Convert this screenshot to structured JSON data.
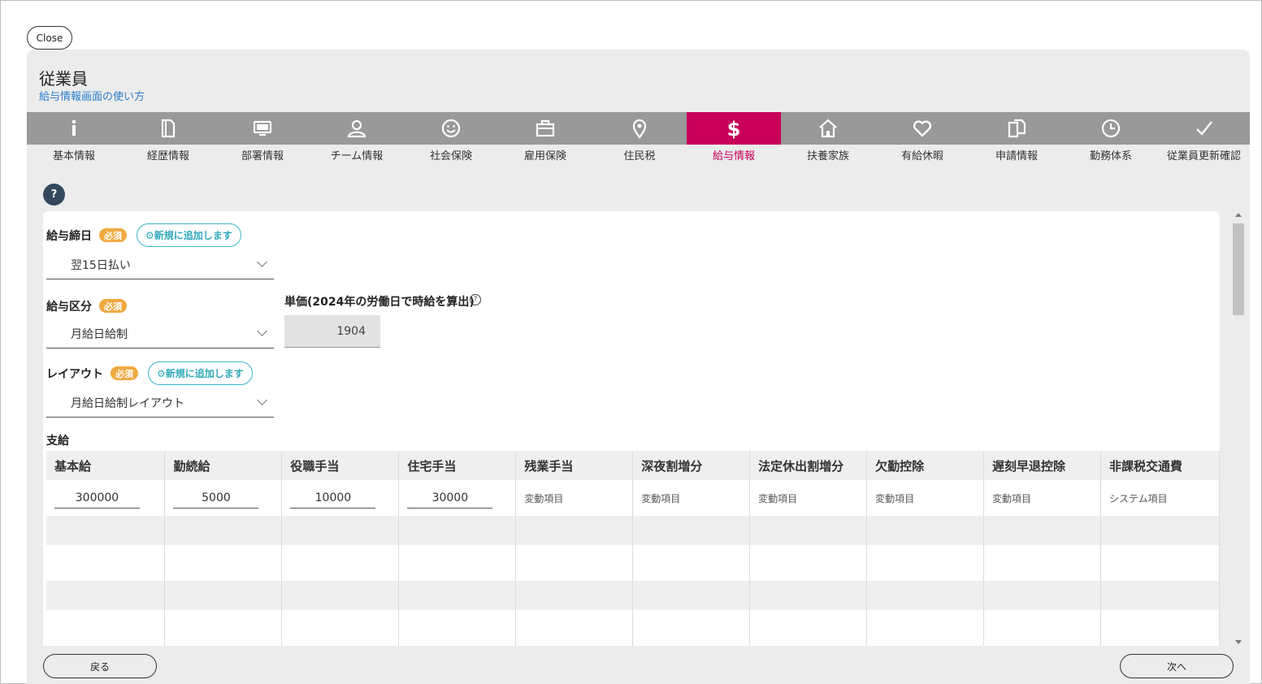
{
  "close_label": "Close",
  "page_title": "従業員",
  "help_link": "給与情報画面の使い方",
  "tabs": [
    {
      "label": "基本情報",
      "icon": "info-icon"
    },
    {
      "label": "経歴情報",
      "icon": "document-icon"
    },
    {
      "label": "部署情報",
      "icon": "monitor-icon"
    },
    {
      "label": "チーム情報",
      "icon": "person-icon"
    },
    {
      "label": "社会保険",
      "icon": "smiley-icon"
    },
    {
      "label": "雇用保険",
      "icon": "briefcase-icon"
    },
    {
      "label": "住民税",
      "icon": "location-pin-icon"
    },
    {
      "label": "給与情報",
      "icon": "dollar-icon",
      "active": true
    },
    {
      "label": "扶養家族",
      "icon": "house-icon"
    },
    {
      "label": "有給休暇",
      "icon": "heart-icon"
    },
    {
      "label": "申請情報",
      "icon": "copy-documents-icon"
    },
    {
      "label": "勤務体系",
      "icon": "clock-icon"
    },
    {
      "label": "従業員更新確認",
      "icon": "checkmark-icon"
    }
  ],
  "colors": {
    "active_tab": "#c8005a",
    "tab_bg": "#999999",
    "required_badge": "#f0a940",
    "add_button": "#3bb8c8"
  },
  "help_icon_text": "?",
  "fields": {
    "closing_day": {
      "label": "給与締日",
      "required": "必須",
      "add_new": "新規に追加します",
      "value": "翌15日払い"
    },
    "pay_type": {
      "label": "給与区分",
      "required": "必須",
      "value": "月給日給制"
    },
    "unit_price": {
      "label": "単価(2024年の労働日で時給を算出)",
      "info": "?",
      "value": "1904"
    },
    "layout": {
      "label": "レイアウト",
      "required": "必須",
      "add_new": "新規に追加します",
      "value": "月給日給制レイアウト"
    }
  },
  "payment": {
    "section_title": "支給",
    "columns": [
      "基本給",
      "勤続給",
      "役職手当",
      "住宅手当",
      "残業手当",
      "深夜割増分",
      "法定休出割増分",
      "欠勤控除",
      "遅刻早退控除",
      "非課税交通費"
    ],
    "row": [
      "300000",
      "5000",
      "10000",
      "30000",
      "変動項目",
      "変動項目",
      "変動項目",
      "変動項目",
      "変動項目",
      "システム項目"
    ]
  },
  "back_label": "戻る",
  "next_label": "次へ"
}
